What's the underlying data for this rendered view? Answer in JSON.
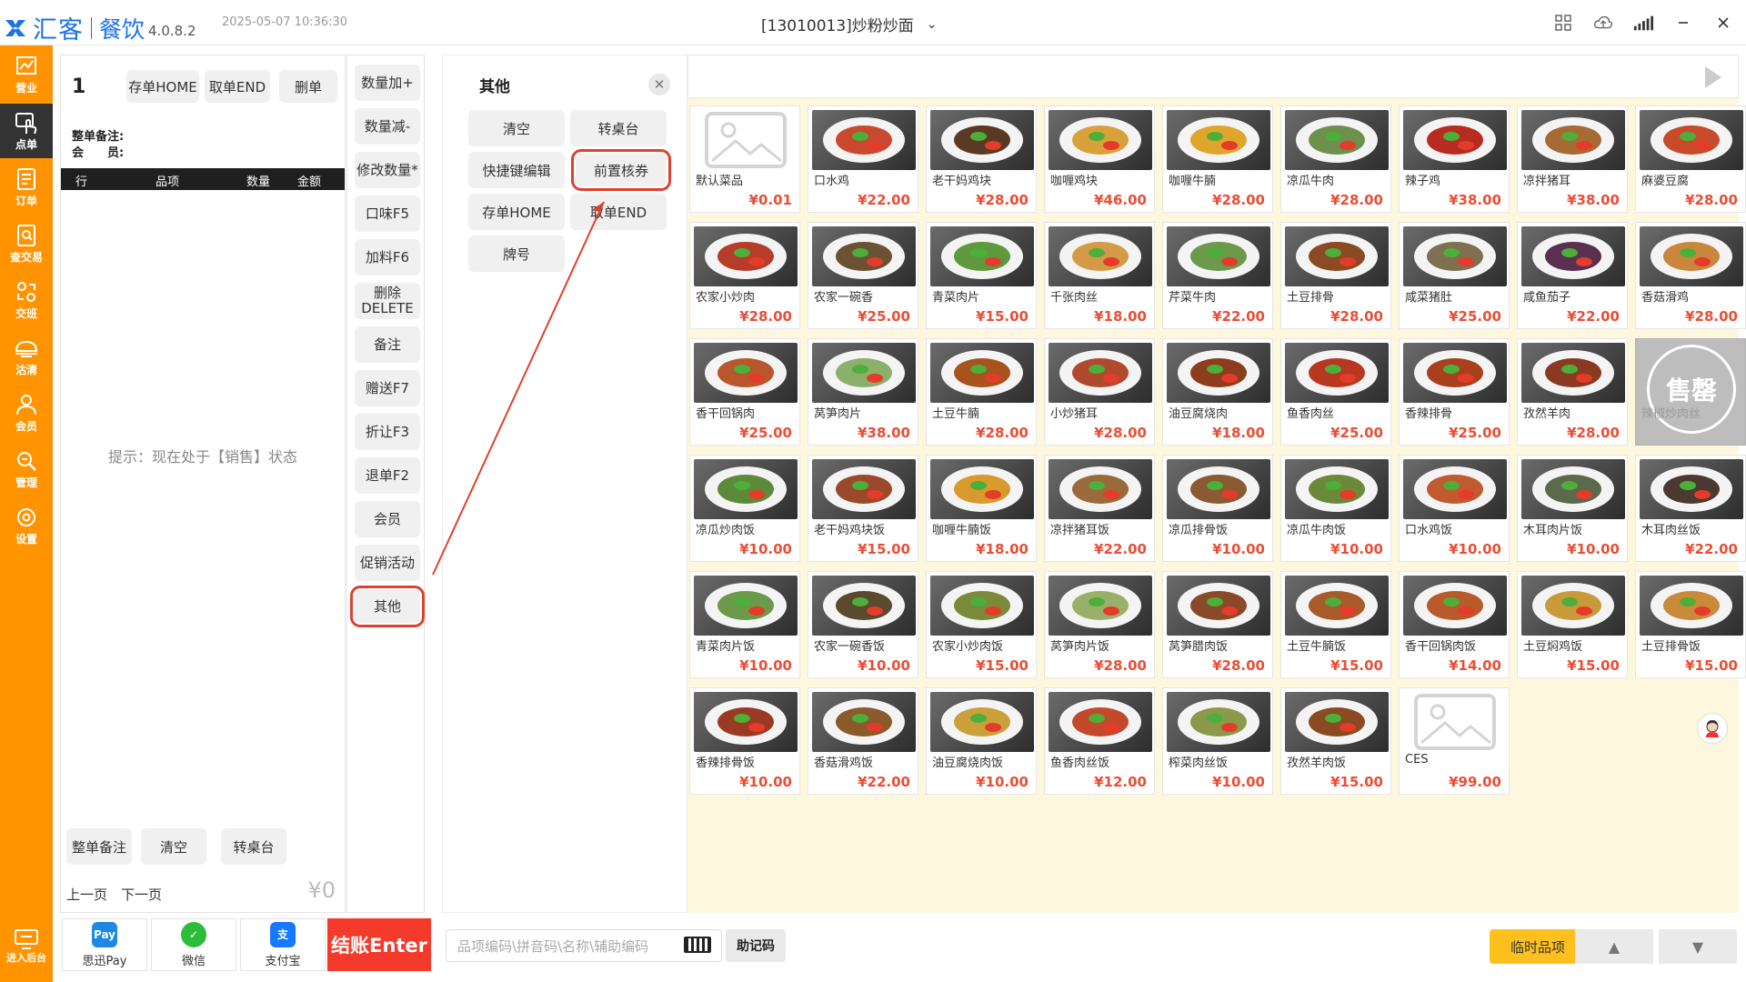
{
  "titlebar": {
    "brand": "汇客",
    "app_name": "餐饮",
    "version": "4.0.8.2",
    "datetime": "2025-05-07 10:36:30",
    "store": "[13010013]炒粉炒面"
  },
  "nav": [
    {
      "label": "营业",
      "icon": "chart-icon"
    },
    {
      "label": "点单",
      "icon": "touch-icon",
      "active": true
    },
    {
      "label": "订单",
      "icon": "document-icon"
    },
    {
      "label": "查交易",
      "icon": "search-doc-icon"
    },
    {
      "label": "交班",
      "icon": "shift-icon"
    },
    {
      "label": "沽清",
      "icon": "dish-clear-icon"
    },
    {
      "label": "会员",
      "icon": "user-icon"
    },
    {
      "label": "管理",
      "icon": "manage-icon"
    },
    {
      "label": "设置",
      "icon": "gear-icon"
    }
  ],
  "back_office": "进入后台",
  "order": {
    "number": "1",
    "save_home": "存单HOME",
    "fetch_end": "取单END",
    "delete_order": "删单",
    "remark_label": "整单备注:",
    "member_label": "会　　员:",
    "columns": [
      "行",
      "品项",
      "数量",
      "金额"
    ],
    "hint": "提示：现在处于【销售】状态",
    "bottom_buttons": [
      "整单备注",
      "清空",
      "转桌台"
    ],
    "prev_page": "上一页",
    "next_page": "下一页",
    "total": "¥0"
  },
  "functions": [
    "数量加+",
    "数量减-",
    "修改数量*",
    "口味F5",
    "加料F6",
    "删除\nDELETE",
    "备注",
    "赠送F7",
    "折让F3",
    "退单F2",
    "会员",
    "促销活动",
    "其他"
  ],
  "popup": {
    "title": "其他",
    "buttons": [
      "清空",
      "转桌台",
      "快捷键编辑",
      "前置核券",
      "存单HOME",
      "取单END",
      "牌号"
    ]
  },
  "dishes": [
    {
      "name": "默认菜品",
      "price": "¥0.01",
      "placeholder": true
    },
    {
      "name": "口水鸡",
      "price": "¥22.00",
      "color": "#c9492f"
    },
    {
      "name": "老干妈鸡块",
      "price": "¥28.00",
      "color": "#5a3a25"
    },
    {
      "name": "咖喱鸡块",
      "price": "¥46.00",
      "color": "#d9a13a"
    },
    {
      "name": "咖喱牛腩",
      "price": "¥28.00",
      "color": "#e0a52c"
    },
    {
      "name": "凉瓜牛肉",
      "price": "¥28.00",
      "color": "#6f8f4d"
    },
    {
      "name": "辣子鸡",
      "price": "¥38.00",
      "color": "#b82c1f"
    },
    {
      "name": "凉拌猪耳",
      "price": "¥38.00",
      "color": "#a86a34"
    },
    {
      "name": "麻婆豆腐",
      "price": "¥28.00",
      "color": "#c74b2a"
    },
    {
      "name": "农家小炒肉",
      "price": "¥28.00",
      "color": "#b53d2a"
    },
    {
      "name": "农家一碗香",
      "price": "¥25.00",
      "color": "#6b5232"
    },
    {
      "name": "青菜肉片",
      "price": "¥15.00",
      "color": "#5e9a3d"
    },
    {
      "name": "千张肉丝",
      "price": "¥18.00",
      "color": "#d59a45"
    },
    {
      "name": "芹菜牛肉",
      "price": "¥22.00",
      "color": "#6a9a4a"
    },
    {
      "name": "土豆排骨",
      "price": "¥28.00",
      "color": "#8a4b22"
    },
    {
      "name": "咸菜猪肚",
      "price": "¥25.00",
      "color": "#7d7152"
    },
    {
      "name": "咸鱼茄子",
      "price": "¥22.00",
      "color": "#5a3050"
    },
    {
      "name": "香菇滑鸡",
      "price": "¥28.00",
      "color": "#c9863c"
    },
    {
      "name": "香干回锅肉",
      "price": "¥25.00",
      "color": "#b8562c"
    },
    {
      "name": "莴笋肉片",
      "price": "¥38.00",
      "color": "#8bb06b"
    },
    {
      "name": "土豆牛腩",
      "price": "¥28.00",
      "color": "#a8521e"
    },
    {
      "name": "小炒猪耳",
      "price": "¥28.00",
      "color": "#b04a2e"
    },
    {
      "name": "油豆腐烧肉",
      "price": "¥18.00",
      "color": "#8c3d1c"
    },
    {
      "name": "鱼香肉丝",
      "price": "¥25.00",
      "color": "#b8381f"
    },
    {
      "name": "香辣排骨",
      "price": "¥25.00",
      "color": "#a8401f"
    },
    {
      "name": "孜然羊肉",
      "price": "¥28.00",
      "color": "#8a3a22"
    },
    {
      "name": "辣椒炒肉丝",
      "price": "",
      "soldout": true,
      "soldout_label": "售罄"
    },
    {
      "name": "凉瓜炒肉饭",
      "price": "¥10.00",
      "color": "#5d8a3a"
    },
    {
      "name": "老干妈鸡块饭",
      "price": "¥15.00",
      "color": "#9a4a2a"
    },
    {
      "name": "咖喱牛腩饭",
      "price": "¥18.00",
      "color": "#d89a2c"
    },
    {
      "name": "凉拌猪耳饭",
      "price": "¥22.00",
      "color": "#9a6a3a"
    },
    {
      "name": "凉瓜排骨饭",
      "price": "¥10.00",
      "color": "#8a5a32"
    },
    {
      "name": "凉瓜牛肉饭",
      "price": "¥10.00",
      "color": "#6a8a3a"
    },
    {
      "name": "口水鸡饭",
      "price": "¥10.00",
      "color": "#c25a30"
    },
    {
      "name": "木耳肉片饭",
      "price": "¥10.00",
      "color": "#5a6a4a"
    },
    {
      "name": "木耳肉丝饭",
      "price": "¥22.00",
      "color": "#4a3a32"
    },
    {
      "name": "青菜肉片饭",
      "price": "¥10.00",
      "color": "#6a9a4a"
    },
    {
      "name": "农家一碗香饭",
      "price": "¥10.00",
      "color": "#5a4a2e"
    },
    {
      "name": "农家小炒肉饭",
      "price": "¥15.00",
      "color": "#7a8a3a"
    },
    {
      "name": "莴笋肉片饭",
      "price": "¥28.00",
      "color": "#9ab06a"
    },
    {
      "name": "莴笋腊肉饭",
      "price": "¥28.00",
      "color": "#8a4a2a"
    },
    {
      "name": "土豆牛腩饭",
      "price": "¥15.00",
      "color": "#a85a2a"
    },
    {
      "name": "香干回锅肉饭",
      "price": "¥14.00",
      "color": "#b85a2a"
    },
    {
      "name": "土豆焖鸡饭",
      "price": "¥15.00",
      "color": "#c99a3a"
    },
    {
      "name": "土豆排骨饭",
      "price": "¥15.00",
      "color": "#c98a3a"
    },
    {
      "name": "香辣排骨饭",
      "price": "¥10.00",
      "color": "#9a3a22"
    },
    {
      "name": "香菇滑鸡饭",
      "price": "¥22.00",
      "color": "#8a5a2a"
    },
    {
      "name": "油豆腐烧肉饭",
      "price": "¥10.00",
      "color": "#c9a03a"
    },
    {
      "name": "鱼香肉丝饭",
      "price": "¥12.00",
      "color": "#c24a2a"
    },
    {
      "name": "榨菜肉丝饭",
      "price": "¥10.00",
      "color": "#8a9a4a"
    },
    {
      "name": "孜然羊肉饭",
      "price": "¥15.00",
      "color": "#8a4a22"
    },
    {
      "name": "CES",
      "price": "¥99.00",
      "placeholder": true
    }
  ],
  "bottom": {
    "pay_siyun": "思迅Pay",
    "pay_wechat": "微信",
    "pay_alipay": "支付宝",
    "checkout": "结账Enter",
    "code_placeholder": "品项编码\\拼音码\\名称\\辅助编码",
    "mnemonic": "助记码",
    "temp_item": "临时品项"
  },
  "colors": {
    "nav": "#ff9400",
    "brand": "#1a73e8",
    "price": "#ea4e36",
    "checkout": "#f43a2a",
    "highlight": "#e0412e",
    "dish_bg": "#fdf7dd"
  }
}
